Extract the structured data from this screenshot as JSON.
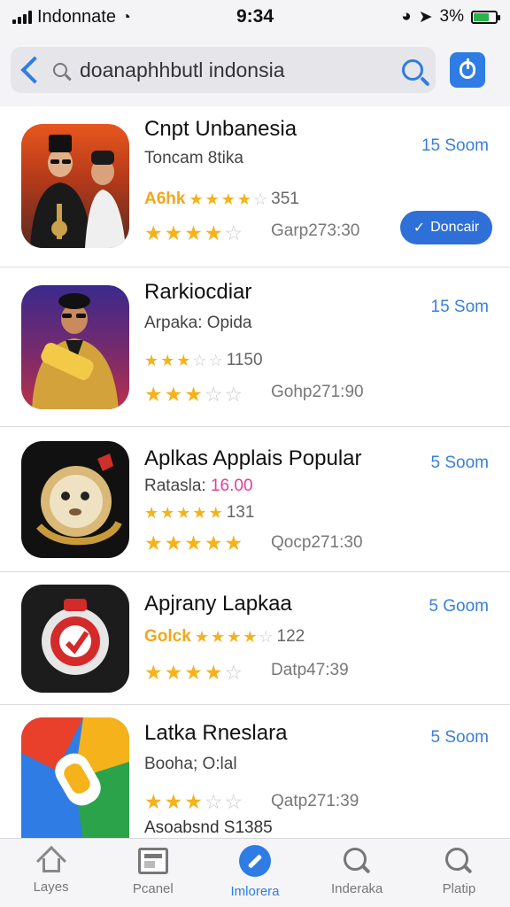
{
  "status": {
    "carrier": "Indonnate",
    "time": "9:34",
    "battery": "3%"
  },
  "search": {
    "query": "doanaphhbutl indonsia"
  },
  "apps": [
    {
      "name": "Cnpt Unbanesia",
      "subtitle": "Toncam 8tika",
      "rating_label": "A6hk",
      "rating_count": "351",
      "stars": 3.5,
      "code": "Garp273:30",
      "size": "15 Soom",
      "button": "Doncair",
      "button_icon": "check-icon"
    },
    {
      "name": "Rarkiocdiar",
      "subtitle": "Arpaka: Opida",
      "rating_label": "",
      "rating_count": "1150",
      "stars": 2.5,
      "code": "Gohp271:90",
      "size": "15 Som"
    },
    {
      "name": "Aplkas Applais Popular",
      "subtitle": "Ratasla:",
      "subtitle_value": "16.00",
      "rating_label": "",
      "rating_count": "131",
      "stars": 4.5,
      "code": "Qocp271:30",
      "size": "5 Soom"
    },
    {
      "name": "Apjrany Lapkaa",
      "subtitle": "",
      "rating_label": "Golck",
      "rating_count": "122",
      "stars": 4,
      "code": "Datp47:39",
      "size": "5 Goom"
    },
    {
      "name": "Latka Rneslara",
      "subtitle": "Booha; O:lal",
      "rating_label": "",
      "rating_count": "",
      "stars": 3,
      "code": "Qatp271:39",
      "size": "5 Soom",
      "extra": "Asoabsnd S1385"
    }
  ],
  "tabs": [
    {
      "label": "Layes",
      "icon": "home-icon"
    },
    {
      "label": "Pcanel",
      "icon": "panel-icon"
    },
    {
      "label": "Imlorera",
      "icon": "today-icon",
      "active": true
    },
    {
      "label": "Inderaka",
      "icon": "search-icon"
    },
    {
      "label": "Platip",
      "icon": "search-icon"
    }
  ],
  "colors": {
    "accent": "#2f7ce4",
    "star": "#f5b21a",
    "rating_label": "#f0a81c",
    "subtitle_highlight": "#e0409a"
  }
}
